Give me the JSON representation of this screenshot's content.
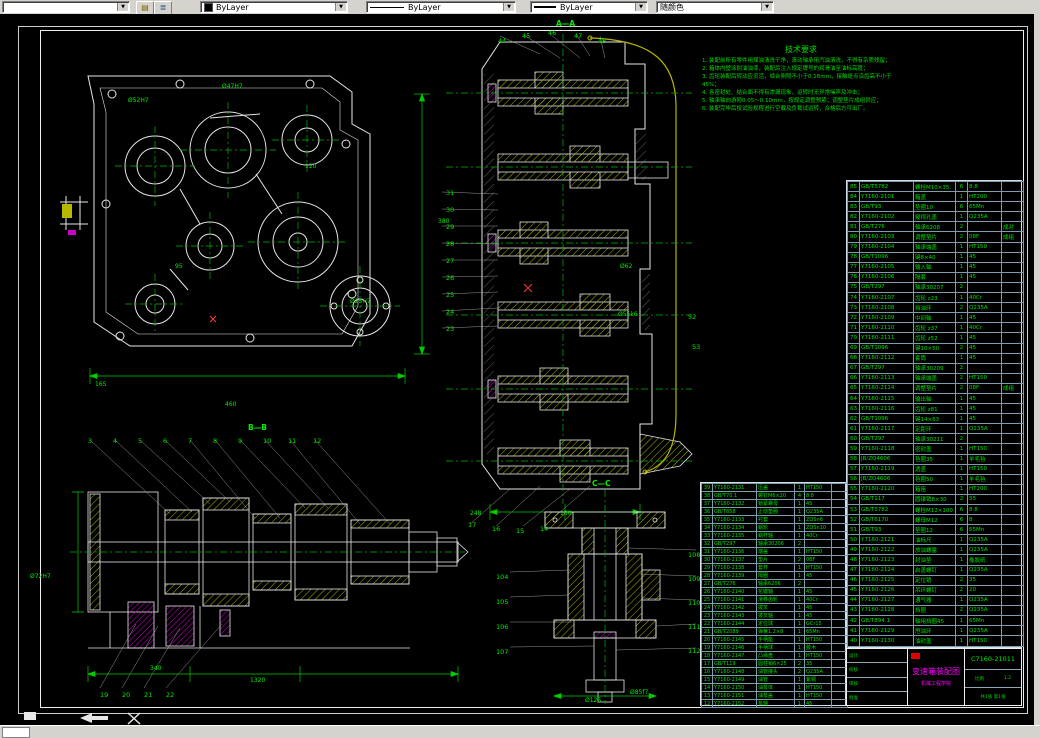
{
  "toolbar": {
    "layer_value": "",
    "color_value": "ByLayer",
    "linetype_value": "ByLayer",
    "lineweight_value": "ByLayer",
    "plotstyle_value": "随颜色"
  },
  "drawing": {
    "notes": {
      "title": "技术要求",
      "lines": [
        "1. 装配前所有零件用煤油清洗干净，滚动轴承用汽油清洗，不得有杂质残留；",
        "2. 箱体内壁涂耐油油漆，装配后注入规定牌号的润滑油至油标高度；",
        "3. 齿轮装配后转动应灵活，啮合侧隙不小于0.16mm，接触斑点沿齿高不小于45%；",
        "4. 各密封处、结合面不得有渗漏现象，运转时无异常噪声及冲击；",
        "5. 轴承轴向游隙0.05～0.10mm，按规定调整预紧；调整垫片成组供应；",
        "6. 装配完毕后按试验规程进行空载及负载试运转，合格后方可出厂。"
      ]
    },
    "viewA": {
      "dims": [
        "460",
        "380",
        "Ø52H7",
        "Ø47H7",
        "120",
        "95",
        "Ø25H7",
        "165"
      ]
    },
    "viewB": {
      "label": "A—A",
      "balloons_top": [
        "44",
        "45",
        "46",
        "47",
        "48"
      ],
      "balloons_left": [
        "31",
        "30",
        "29",
        "28",
        "27",
        "26",
        "25",
        "24",
        "23"
      ],
      "balloons_bottom": [
        "17",
        "16",
        "15",
        "14"
      ],
      "balloons_right": [
        "52",
        "53"
      ],
      "dims": [
        "248",
        "130",
        "Ø62",
        "Ø55k6"
      ]
    },
    "viewC": {
      "label": "B—B",
      "balloons_top": [
        "3",
        "4",
        "5",
        "6",
        "7",
        "8",
        "9",
        "10",
        "11",
        "12"
      ],
      "balloons_bottom": [
        "19",
        "20",
        "21",
        "22"
      ],
      "dims": [
        "1320",
        "340",
        "Ø72H7"
      ]
    },
    "viewD": {
      "label": "C—C",
      "balloons_left": [
        "104",
        "105",
        "106",
        "107"
      ],
      "balloons_right": [
        "108",
        "109",
        "110",
        "111",
        "112"
      ],
      "dims": [
        "Ø125",
        "Ø85f7"
      ]
    },
    "bom_right": {
      "rows": [
        [
          "85",
          "GB/T5782",
          "螺栓M10×35",
          "6",
          "8.8",
          ""
        ],
        [
          "84",
          "Y7160-2101",
          "箱盖",
          "1",
          "HT200",
          ""
        ],
        [
          "83",
          "GB/T93",
          "垫圈10",
          "6",
          "65Mn",
          ""
        ],
        [
          "82",
          "Y7160-2102",
          "窥视孔盖",
          "1",
          "Q235A",
          ""
        ],
        [
          "81",
          "GB/T276",
          "轴承6208",
          "2",
          "",
          "成对"
        ],
        [
          "80",
          "Y7160-2103",
          "调整垫片",
          "2",
          "08F",
          "成组"
        ],
        [
          "79",
          "Y7160-2104",
          "轴承端盖",
          "1",
          "HT150",
          ""
        ],
        [
          "78",
          "GB/T1096",
          "键8×40",
          "1",
          "45",
          ""
        ],
        [
          "77",
          "Y7160-2105",
          "输入轴",
          "1",
          "45",
          ""
        ],
        [
          "76",
          "Y7160-2106",
          "隔套",
          "1",
          "45",
          ""
        ],
        [
          "75",
          "GB/T297",
          "轴承30207",
          "2",
          "",
          ""
        ],
        [
          "74",
          "Y7160-2107",
          "齿轮 z23",
          "1",
          "40Cr",
          ""
        ],
        [
          "73",
          "Y7160-2108",
          "挡油环",
          "2",
          "Q235A",
          ""
        ],
        [
          "72",
          "Y7160-2109",
          "中间轴",
          "1",
          "45",
          ""
        ],
        [
          "71",
          "Y7160-2110",
          "齿轮 z37",
          "1",
          "40Cr",
          ""
        ],
        [
          "70",
          "Y7160-2111",
          "齿轮 z52",
          "1",
          "45",
          ""
        ],
        [
          "69",
          "GB/T1096",
          "键10×50",
          "2",
          "45",
          ""
        ],
        [
          "68",
          "Y7160-2112",
          "套筒",
          "1",
          "45",
          ""
        ],
        [
          "67",
          "GB/T297",
          "轴承30209",
          "2",
          "",
          ""
        ],
        [
          "66",
          "Y7160-2113",
          "轴承端盖",
          "2",
          "HT150",
          ""
        ],
        [
          "65",
          "Y7160-2114",
          "调整垫片",
          "2",
          "08F",
          "成组"
        ],
        [
          "64",
          "Y7160-2115",
          "输出轴",
          "1",
          "45",
          ""
        ],
        [
          "63",
          "Y7160-2116",
          "齿轮 z81",
          "1",
          "45",
          ""
        ],
        [
          "62",
          "GB/T1096",
          "键14×63",
          "1",
          "45",
          ""
        ],
        [
          "61",
          "Y7160-2117",
          "定距环",
          "1",
          "Q235A",
          ""
        ],
        [
          "60",
          "GB/T297",
          "轴承30211",
          "2",
          "",
          ""
        ],
        [
          "59",
          "Y7160-2118",
          "密封盖",
          "1",
          "HT150",
          ""
        ],
        [
          "58",
          "JB/ZQ4606",
          "毡圈35",
          "1",
          "羊毛毡",
          ""
        ],
        [
          "57",
          "Y7160-2119",
          "透盖",
          "1",
          "HT150",
          ""
        ],
        [
          "56",
          "JB/ZQ4606",
          "毡圈50",
          "1",
          "羊毛毡",
          ""
        ],
        [
          "55",
          "Y7160-2120",
          "箱座",
          "1",
          "HT200",
          ""
        ],
        [
          "54",
          "GB/T117",
          "圆锥销8×30",
          "2",
          "35",
          ""
        ],
        [
          "53",
          "GB/T5782",
          "螺栓M12×100",
          "6",
          "8.8",
          ""
        ],
        [
          "52",
          "GB/T6170",
          "螺母M12",
          "6",
          "8",
          ""
        ],
        [
          "51",
          "GB/T93",
          "垫圈12",
          "6",
          "65Mn",
          ""
        ],
        [
          "50",
          "Y7160-2121",
          "油标尺",
          "1",
          "Q235A",
          ""
        ],
        [
          "49",
          "Y7160-2122",
          "放油螺塞",
          "1",
          "Q235A",
          ""
        ],
        [
          "48",
          "Y7160-2123",
          "封油垫",
          "1",
          "橡胶纸",
          ""
        ],
        [
          "47",
          "Y7160-2124",
          "启盖螺钉",
          "1",
          "Q235A",
          ""
        ],
        [
          "46",
          "Y7160-2125",
          "定位销",
          "2",
          "35",
          ""
        ],
        [
          "45",
          "Y7160-2126",
          "吊环螺钉",
          "2",
          "20",
          ""
        ],
        [
          "44",
          "Y7160-2127",
          "通气器",
          "1",
          "Q235A",
          ""
        ],
        [
          "43",
          "Y7160-2128",
          "挡圈",
          "2",
          "Q235A",
          ""
        ],
        [
          "42",
          "GB/T894.1",
          "轴用挡圈45",
          "1",
          "65Mn",
          ""
        ],
        [
          "41",
          "Y7160-2129",
          "甩油环",
          "1",
          "Q235A",
          ""
        ],
        [
          "40",
          "Y7160-2130",
          "油封盖",
          "1",
          "HT150",
          ""
        ]
      ]
    },
    "bom_left": {
      "rows": [
        [
          "39",
          "Y7160-2131",
          "压盖",
          "1",
          "HT150",
          ""
        ],
        [
          "38",
          "GB/T70.1",
          "螺钉M6×20",
          "4",
          "8.8",
          ""
        ],
        [
          "37",
          "Y7160-2132",
          "锁紧螺母",
          "1",
          "45",
          ""
        ],
        [
          "36",
          "GB/T858",
          "止动垫圈",
          "1",
          "Q235A",
          ""
        ],
        [
          "35",
          "Y7160-2133",
          "衬套",
          "1",
          "ZQSn6",
          ""
        ],
        [
          "34",
          "Y7160-2134",
          "蜗轮",
          "1",
          "ZQSn10",
          ""
        ],
        [
          "33",
          "Y7160-2135",
          "蜗杆轴",
          "1",
          "40Cr",
          ""
        ],
        [
          "32",
          "GB/T297",
          "轴承30206",
          "2",
          "",
          ""
        ],
        [
          "31",
          "Y7160-2136",
          "端盖",
          "1",
          "HT150",
          ""
        ],
        [
          "30",
          "Y7160-2137",
          "垫片",
          "2",
          "08F",
          ""
        ],
        [
          "29",
          "Y7160-2138",
          "套杯",
          "1",
          "HT150",
          ""
        ],
        [
          "28",
          "Y7160-2139",
          "隔圈",
          "1",
          "45",
          ""
        ],
        [
          "27",
          "GB/T276",
          "轴承6206",
          "2",
          "",
          ""
        ],
        [
          "26",
          "Y7160-2140",
          "花键轴",
          "1",
          "45",
          ""
        ],
        [
          "25",
          "Y7160-2141",
          "滑移齿轮",
          "1",
          "40Cr",
          ""
        ],
        [
          "24",
          "Y7160-2142",
          "拨叉",
          "1",
          "45",
          ""
        ],
        [
          "23",
          "Y7160-2143",
          "拨叉轴",
          "1",
          "45",
          ""
        ],
        [
          "22",
          "Y7160-2144",
          "定位球",
          "1",
          "GCr15",
          ""
        ],
        [
          "21",
          "GB/T2089",
          "弹簧1.2×8",
          "1",
          "65Mn",
          ""
        ],
        [
          "20",
          "Y7160-2145",
          "手柄座",
          "1",
          "HT150",
          ""
        ],
        [
          "19",
          "Y7160-2146",
          "手柄球",
          "1",
          "胶木",
          ""
        ],
        [
          "18",
          "Y7160-2147",
          "凸缘盘",
          "1",
          "HT150",
          ""
        ],
        [
          "17",
          "GB/T119",
          "圆柱销6×25",
          "2",
          "35",
          ""
        ],
        [
          "16",
          "Y7160-2148",
          "油管接头",
          "2",
          "Q235A",
          ""
        ],
        [
          "15",
          "Y7160-2149",
          "油管",
          "1",
          "紫铜",
          ""
        ],
        [
          "14",
          "Y7160-2150",
          "油泵体",
          "1",
          "HT150",
          ""
        ],
        [
          "13",
          "Y7160-2151",
          "油泵盖",
          "1",
          "HT150",
          ""
        ],
        [
          "12",
          "Y7160-2152",
          "泵轴",
          "1",
          "45",
          ""
        ]
      ]
    },
    "title_block": {
      "product_name": "变速箱装配图",
      "drawing_no": "C7160-21011",
      "company": "机械工程学院",
      "scale_label": "比例",
      "scale": "1:2",
      "sheet": "共1张 第1张",
      "sign_labels": [
        "设计",
        "校核",
        "审核",
        "批准"
      ]
    }
  }
}
